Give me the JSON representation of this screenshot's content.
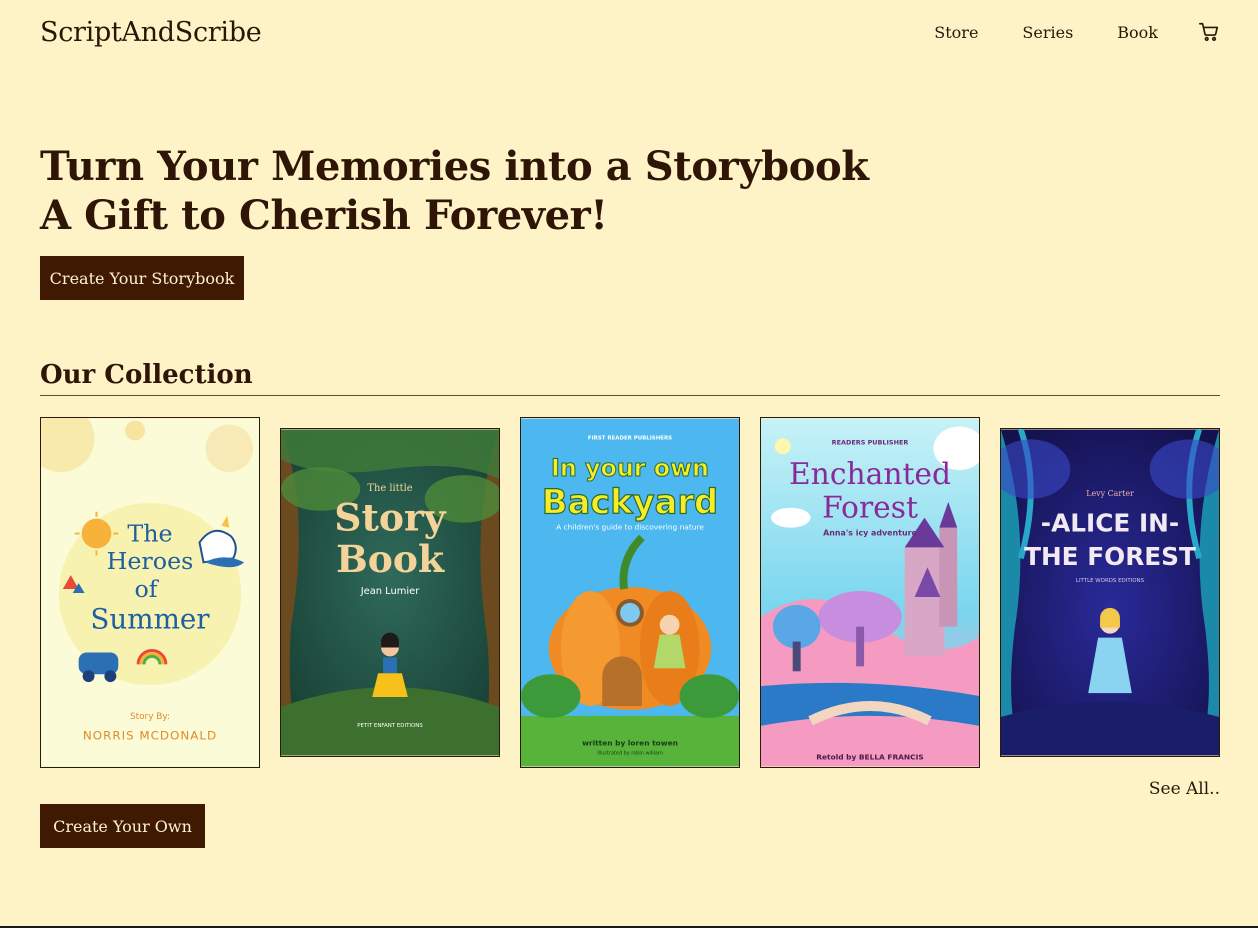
{
  "header": {
    "brand": "ScriptAndScribe",
    "nav": [
      {
        "label": "Store"
      },
      {
        "label": "Series"
      },
      {
        "label": "Book"
      }
    ],
    "cart_icon": "shopping-cart-icon"
  },
  "hero": {
    "line1": "Turn Your Memories into a Storybook",
    "line2": "A Gift to Cherish Forever!",
    "cta_label": "Create Your Storybook"
  },
  "collection": {
    "title": "Our Collection",
    "see_all": "See All..",
    "create_own_label": "Create Your Own",
    "books": [
      {
        "title_lines": [
          "The",
          "Heroes",
          "of",
          "Summer"
        ],
        "byline_label": "Story By:",
        "author": "NORRIS MCDONALD"
      },
      {
        "kicker": "The little",
        "title_lines": [
          "Story",
          "Book"
        ],
        "author": "Jean Lumier",
        "publisher": "PETIT ENFANT EDITIONS"
      },
      {
        "publisher": "FIRST READER PUBLISHERS",
        "title_lines": [
          "In your own",
          "Backyard"
        ],
        "subtitle": "A children's guide to discovering nature",
        "author": "written by loren towen",
        "illustrator": "illustrated by robin william"
      },
      {
        "publisher": "READERS PUBLISHER",
        "title_lines": [
          "Enchanted",
          "Forest"
        ],
        "subtitle": "Anna's icy adventure",
        "author": "Retold by BELLA FRANCIS"
      },
      {
        "author": "Levy Carter",
        "title_lines": [
          "-ALICE IN-",
          "THE FOREST"
        ],
        "publisher": "LITTLE WORDS EDITIONS"
      }
    ]
  },
  "colors": {
    "background": "#fef3c7",
    "button": "#401903",
    "text": "#2e1506"
  }
}
